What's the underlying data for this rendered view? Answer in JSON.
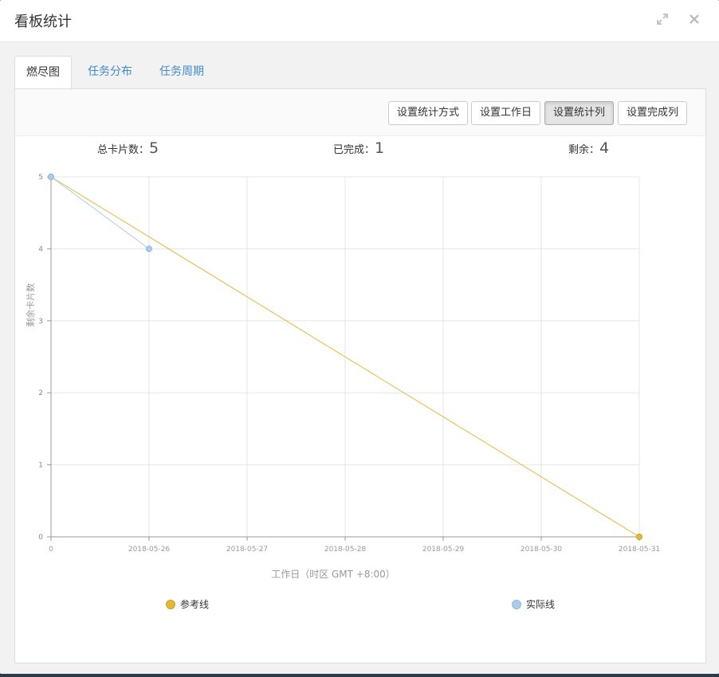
{
  "modal": {
    "title": "看板统计"
  },
  "tabs": [
    {
      "label": "燃尽图",
      "active": true
    },
    {
      "label": "任务分布",
      "active": false
    },
    {
      "label": "任务周期",
      "active": false
    }
  ],
  "toolbar": {
    "buttons": [
      {
        "label": "设置统计方式"
      },
      {
        "label": "设置工作日"
      },
      {
        "label": "设置统计列"
      },
      {
        "label": "设置完成列"
      }
    ]
  },
  "stats": {
    "total_label": "总卡片数：",
    "total_value": "5",
    "done_label": "已完成：",
    "done_value": "1",
    "remaining_label": "剩余：",
    "remaining_value": "4"
  },
  "colors": {
    "reference": "#e3b936",
    "actual": "#a9cdea",
    "tab_link": "#428bca"
  },
  "icons": {
    "expand": "expand-icon",
    "close": "close-icon"
  },
  "chart_data": {
    "type": "line",
    "title": "",
    "xlabel": "工作日（时区 GMT +8:00）",
    "ylabel": "剩余卡片数",
    "categories": [
      "0",
      "2018-05-26",
      "2018-05-27",
      "2018-05-28",
      "2018-05-29",
      "2018-05-30",
      "2018-05-31"
    ],
    "ylim": [
      0,
      5
    ],
    "yticks": [
      0,
      1,
      2,
      3,
      4,
      5
    ],
    "grid": true,
    "legend_position": "bottom",
    "series": [
      {
        "name": "参考线",
        "values": [
          5,
          null,
          null,
          null,
          null,
          null,
          0
        ],
        "color": "#e3b936"
      },
      {
        "name": "实际线",
        "values": [
          5,
          4,
          null,
          null,
          null,
          null,
          null
        ],
        "color": "#a9cdea"
      }
    ]
  }
}
